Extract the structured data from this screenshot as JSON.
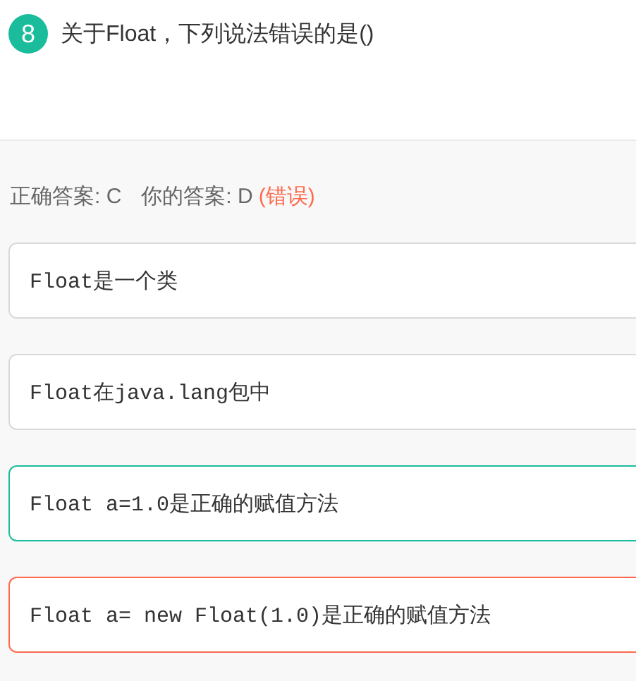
{
  "question": {
    "number": "8",
    "text": "关于Float，下列说法错误的是()"
  },
  "answer": {
    "correct": "正确答案: C",
    "yours": "你的答案: D",
    "verdict": "(错误)",
    "is_right": false
  },
  "options": [
    {
      "text": "Float是一个类",
      "kind": "plain"
    },
    {
      "text": "Float在java.lang包中",
      "kind": "plain"
    },
    {
      "text": "Float a=1.0是正确的赋值方法",
      "kind": "right"
    },
    {
      "text": "Float a= new Float(1.0)是正确的赋值方法",
      "kind": "chosen"
    }
  ]
}
